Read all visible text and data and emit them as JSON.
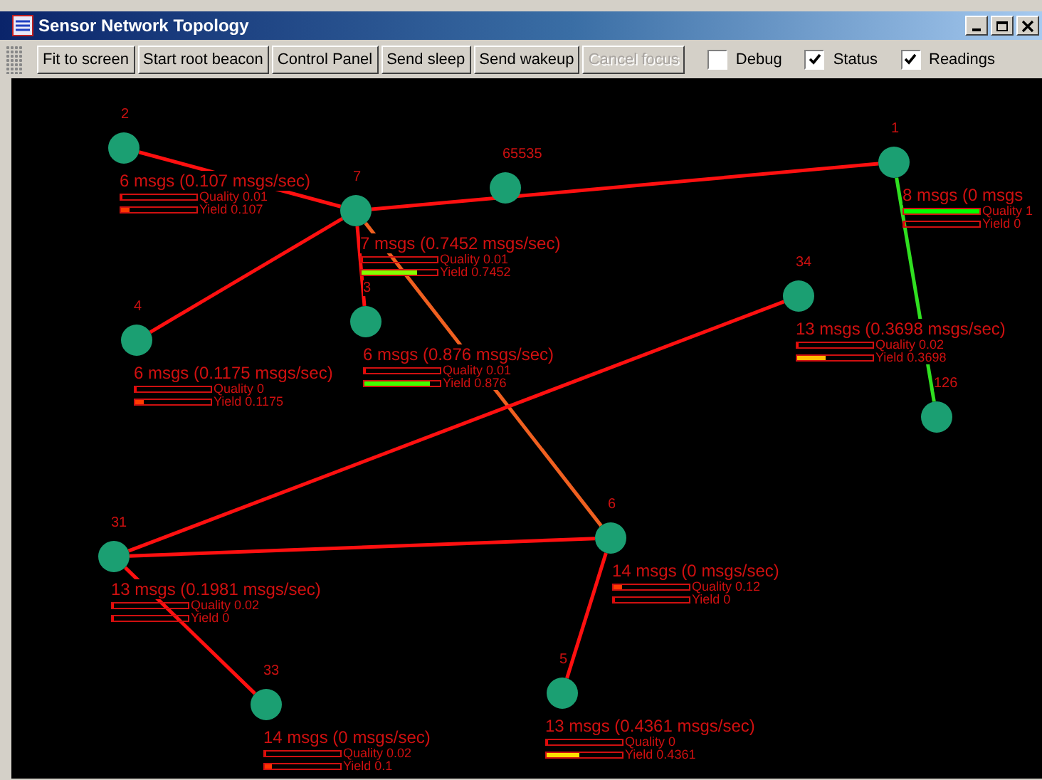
{
  "window": {
    "title": "Sensor Network Topology"
  },
  "toolbar": {
    "buttons": [
      {
        "label": "Fit to screen",
        "disabled": false
      },
      {
        "label": "Start root beacon",
        "disabled": false
      },
      {
        "label": "Control Panel",
        "disabled": false
      },
      {
        "label": "Send sleep",
        "disabled": false
      },
      {
        "label": "Send wakeup",
        "disabled": false
      },
      {
        "label": "Cancel focus",
        "disabled": true
      }
    ],
    "checkboxes": [
      {
        "label": "Debug",
        "checked": false
      },
      {
        "label": "Status",
        "checked": true
      },
      {
        "label": "Readings",
        "checked": true
      }
    ]
  },
  "nodes": [
    {
      "id": "7",
      "stats": {
        "messages": "7 msgs (0.7452 msgs/sec)",
        "quality": {
          "label": "Quality 0.01",
          "level": 0.01
        },
        "yield": {
          "label": "Yield 0.7452",
          "level": 0.7452
        }
      },
      "children": [
        {
          "id": "2",
          "color": "#ff1010",
          "stats": {
            "messages": "6 msgs (0.107 msgs/sec)",
            "quality": {
              "label": "Quality 0.01",
              "level": 0.01
            },
            "yield": {
              "label": "Yield 0.107",
              "level": 0.107
            }
          }
        },
        {
          "id": "4",
          "color": "#ff1010",
          "stats": {
            "messages": "6 msgs (0.1175 msgs/sec)",
            "quality": {
              "label": "Quality 0",
              "level": 0
            },
            "yield": {
              "label": "Yield 0.1175",
              "level": 0.1175
            }
          }
        },
        {
          "id": "3",
          "color": "#ff1010",
          "stats": {
            "messages": "6 msgs (0.876 msgs/sec)",
            "quality": {
              "label": "Quality 0.01",
              "level": 0.01
            },
            "yield": {
              "label": "Yield 0.876",
              "level": 0.876
            }
          }
        },
        {
          "id": "1",
          "color": "#ff1010",
          "stats": {
            "messages": "8 msgs (0 msgs",
            "quality": {
              "label": "Quality 1",
              "level": 1
            },
            "yield": {
              "label": "Yield 0",
              "level": 0
            }
          },
          "children": [
            {
              "id": "126",
              "color": "#30e020"
            }
          ]
        },
        {
          "id": "6",
          "color": "#f06020",
          "stats": {
            "messages": "14 msgs (0 msgs/sec)",
            "quality": {
              "label": "Quality 0.12",
              "level": 0.12
            },
            "yield": {
              "label": "Yield 0",
              "level": 0
            }
          },
          "children": [
            {
              "id": "31",
              "color": "#ff1010",
              "stats": {
                "messages": "13 msgs (0.1981 msgs/sec)",
                "quality": {
                  "label": "Quality 0.02",
                  "level": 0.02
                },
                "yield": {
                  "label": "Yield 0",
                  "level": 0
                }
              },
              "children": [
                {
                  "id": "34",
                  "color": "#ff1010",
                  "stats": {
                    "messages": "13 msgs (0.3698 msgs/sec)",
                    "quality": {
                      "label": "Quality 0.02",
                      "level": 0.02
                    },
                    "yield": {
                      "label": "Yield 0.3698",
                      "level": 0.3698
                    }
                  }
                },
                {
                  "id": "33",
                  "color": "#ff1010",
                  "stats": {
                    "messages": "14 msgs (0 msgs/sec)",
                    "quality": {
                      "label": "Quality 0.02",
                      "level": 0.02
                    },
                    "yield": {
                      "label": "Yield 0.1",
                      "level": 0.1
                    }
                  }
                }
              ]
            },
            {
              "id": "5",
              "color": "#ff1010",
              "stats": {
                "messages": "13 msgs (0.4361 msgs/sec)",
                "quality": {
                  "label": "Quality 0",
                  "level": 0
                },
                "yield": {
                  "label": "Yield 0.4361",
                  "level": 0.4361
                }
              }
            }
          ]
        }
      ]
    },
    {
      "id": "65535"
    }
  ]
}
